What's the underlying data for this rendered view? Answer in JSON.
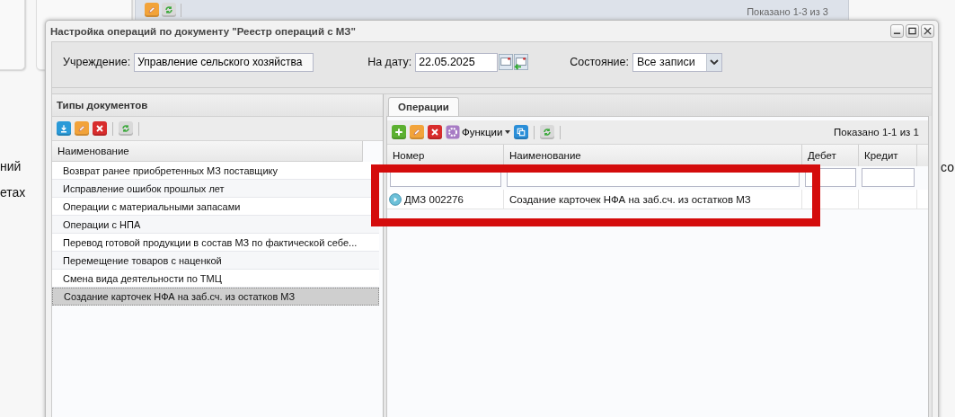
{
  "background": {
    "toolbar": [
      {
        "kind": "edit"
      },
      {
        "kind": "refresh"
      }
    ],
    "counter": "Показано 1-3 из 3",
    "left_texts": [
      "ний",
      "етах"
    ],
    "right_texts": [
      "со"
    ]
  },
  "window": {
    "title": "Настройка операций по документу \"Реестр операций с МЗ\"",
    "controls": [
      {
        "kind": "minimize"
      },
      {
        "kind": "maximize"
      },
      {
        "kind": "close"
      }
    ]
  },
  "filters": {
    "institution_label": "Учреждение:",
    "institution_value": "Управление сельского хозяйства",
    "date_label": "На дату:",
    "date_value": "22.05.2025",
    "state_label": "Состояние:",
    "state_value": "Все записи"
  },
  "left_panel": {
    "title": "Типы документов",
    "toolbar": [
      {
        "kind": "download"
      },
      {
        "kind": "edit"
      },
      {
        "kind": "delete"
      },
      {
        "kind": "separator"
      },
      {
        "kind": "refresh"
      },
      {
        "kind": "separator"
      }
    ],
    "column": "Наименование",
    "rows": [
      {
        "text": "Возврат ранее приобретенных МЗ поставщику",
        "selected": false
      },
      {
        "text": "Исправление ошибок прошлых лет",
        "selected": false
      },
      {
        "text": "Операции с материальными запасами",
        "selected": false
      },
      {
        "text": "Операции с НПА",
        "selected": false
      },
      {
        "text": "Перевод готовой продукции в состав МЗ по фактической себе...",
        "selected": false
      },
      {
        "text": "Перемещение товаров с наценкой",
        "selected": false
      },
      {
        "text": "Смена вида деятельности по ТМЦ",
        "selected": false
      },
      {
        "text": "Создание карточек НФА на заб.сч. из остатков МЗ",
        "selected": true
      }
    ]
  },
  "right_panel": {
    "tabs": [
      {
        "label": "Операции",
        "selected": true
      }
    ],
    "toolbar": [
      {
        "kind": "add"
      },
      {
        "kind": "edit"
      },
      {
        "kind": "delete"
      },
      {
        "kind": "menu",
        "label": "Функции"
      },
      {
        "kind": "copy"
      },
      {
        "kind": "separator"
      },
      {
        "kind": "refresh"
      },
      {
        "kind": "separator"
      }
    ],
    "counter": "Показано 1-1 из 1",
    "columns": [
      "Номер",
      "Наименование",
      "Дебет",
      "Кредит"
    ],
    "rows": [
      {
        "number": "ДМЗ 002276",
        "name": "Создание карточек НФА на заб.сч. из остатков МЗ"
      }
    ]
  },
  "annotation": {
    "kind": "highlight-frame"
  }
}
